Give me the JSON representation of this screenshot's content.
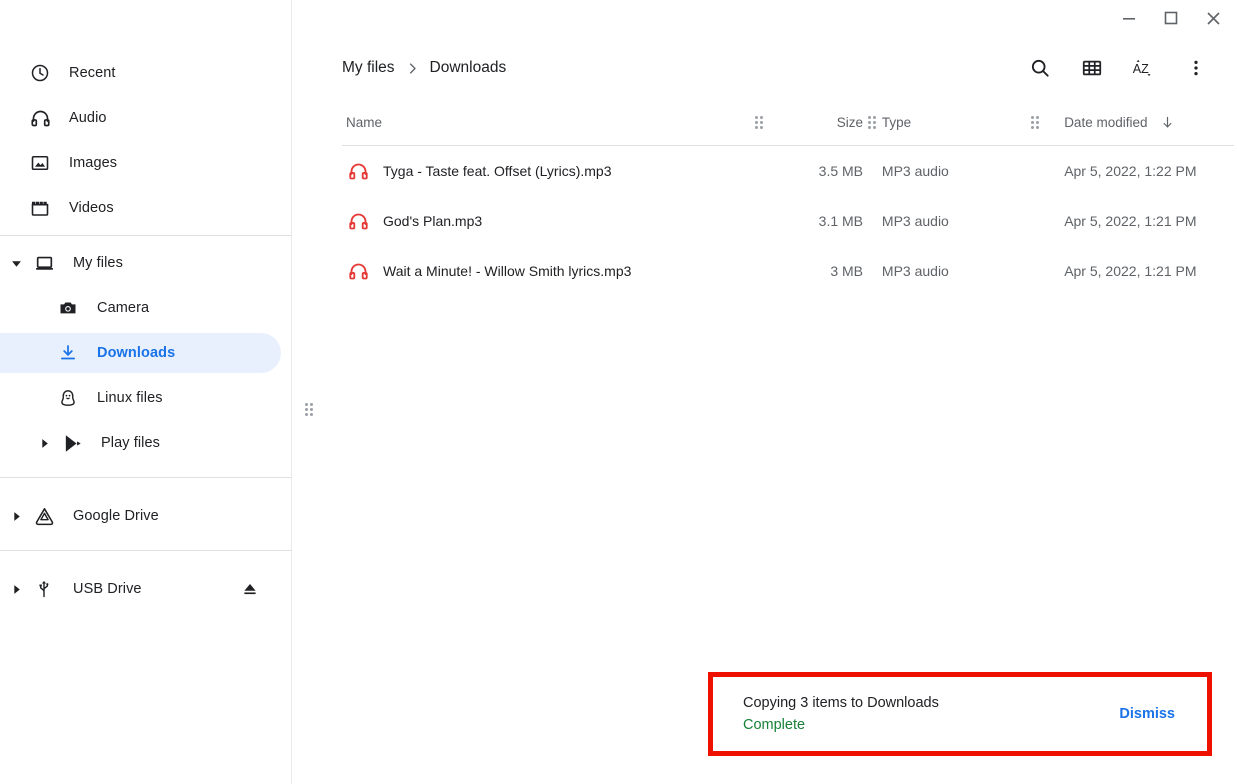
{
  "window": {
    "minimize_label": "Minimize",
    "maximize_label": "Maximize",
    "close_label": "Close"
  },
  "sidebar": {
    "groups": [
      {
        "items": [
          {
            "label": "Recent",
            "icon": "clock-icon",
            "level": 0,
            "twisty": "none",
            "selected": false
          },
          {
            "label": "Audio",
            "icon": "headphones-icon",
            "level": 0,
            "twisty": "none",
            "selected": false
          },
          {
            "label": "Images",
            "icon": "image-icon",
            "level": 0,
            "twisty": "none",
            "selected": false
          },
          {
            "label": "Videos",
            "icon": "video-icon",
            "level": 0,
            "twisty": "none",
            "selected": false
          }
        ]
      },
      {
        "items": [
          {
            "label": "My files",
            "icon": "laptop-icon",
            "level": 0,
            "twisty": "expanded",
            "selected": false
          },
          {
            "label": "Camera",
            "icon": "camera-icon",
            "level": 1,
            "twisty": "none",
            "selected": false
          },
          {
            "label": "Downloads",
            "icon": "download-icon",
            "level": 1,
            "twisty": "none",
            "selected": true
          },
          {
            "label": "Linux files",
            "icon": "linux-penguin-icon",
            "level": 1,
            "twisty": "none",
            "selected": false
          },
          {
            "label": "Play files",
            "icon": "google-play-icon",
            "level": 1,
            "twisty": "collapsed",
            "selected": false
          }
        ]
      },
      {
        "items": [
          {
            "label": "Google Drive",
            "icon": "google-drive-icon",
            "level": 0,
            "twisty": "collapsed",
            "selected": false
          }
        ]
      },
      {
        "items": [
          {
            "label": "USB Drive",
            "icon": "usb-icon",
            "level": 0,
            "twisty": "collapsed",
            "selected": false,
            "eject": "eject-icon"
          }
        ]
      }
    ],
    "splitter": "sidebar-resize-handle"
  },
  "breadcrumb": {
    "root": "My files",
    "separator": "chevron-right-icon",
    "current": "Downloads"
  },
  "toolbar": {
    "search_label": "Search",
    "view_label": "Switch to grid view",
    "sort_label": "Sort A to Z",
    "more_label": "More options"
  },
  "file_list": {
    "columns": {
      "name": "Name",
      "size": "Size",
      "type": "Type",
      "date": "Date modified"
    },
    "sort_direction_icon": "arrow-down-icon",
    "rows": [
      {
        "icon": "audio-file-icon",
        "name": "Tyga - Taste feat. Offset (Lyrics).mp3",
        "size": "3.5 MB",
        "type": "MP3 audio",
        "date": "Apr 5, 2022, 1:22 PM"
      },
      {
        "icon": "audio-file-icon",
        "name": "God's Plan.mp3",
        "size": "3.1 MB",
        "type": "MP3 audio",
        "date": "Apr 5, 2022, 1:21 PM"
      },
      {
        "icon": "audio-file-icon",
        "name": "Wait a Minute! - Willow Smith lyrics.mp3",
        "size": "3 MB",
        "type": "MP3 audio",
        "date": "Apr 5, 2022, 1:21 PM"
      }
    ]
  },
  "toast": {
    "title": "Copying 3 items to Downloads",
    "status": "Complete",
    "dismiss_label": "Dismiss"
  },
  "colors": {
    "accent_blue": "#1a73e8",
    "selected_bg": "#e8f0fe",
    "success_green": "#188038",
    "audio_red": "#e53935",
    "highlight_border": "#ee1100"
  }
}
